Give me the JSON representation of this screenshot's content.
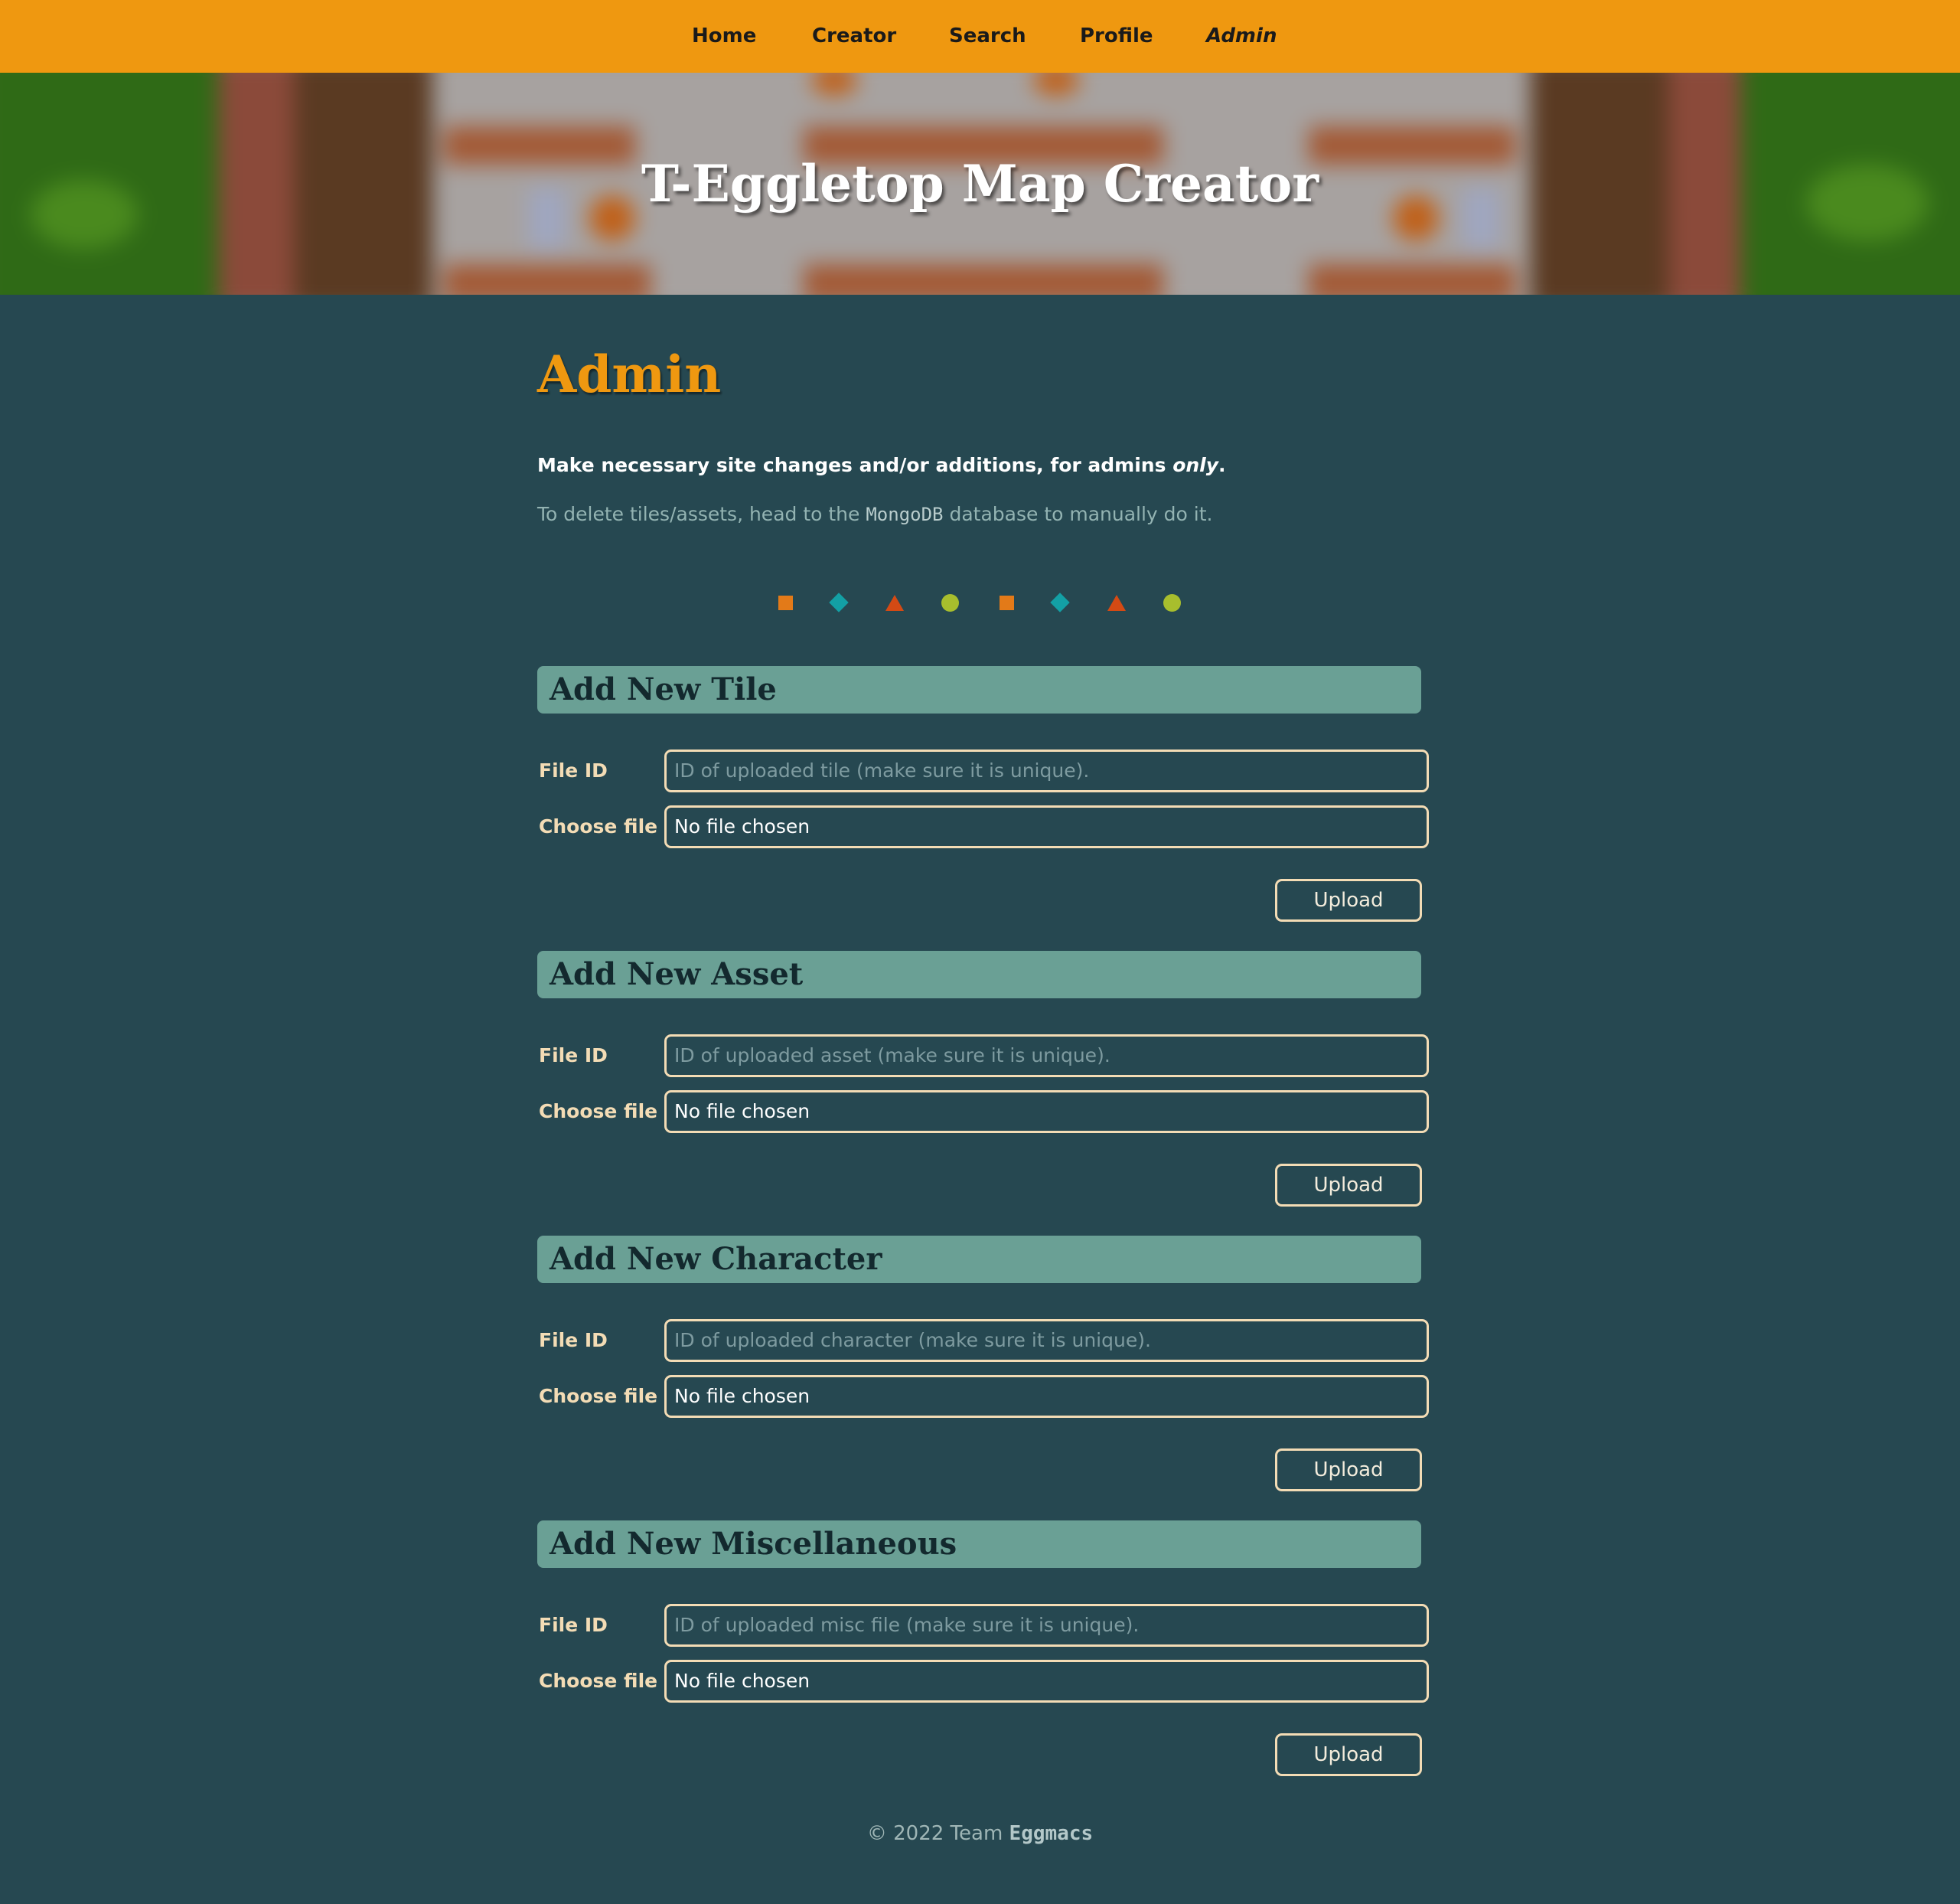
{
  "nav": {
    "items": [
      {
        "label": "Home",
        "active": false
      },
      {
        "label": "Creator",
        "active": false
      },
      {
        "label": "Search",
        "active": false
      },
      {
        "label": "Profile",
        "active": false
      },
      {
        "label": "Admin",
        "active": true
      }
    ],
    "background": "#ef9810"
  },
  "hero": {
    "title": "T-Eggletop Map Creator"
  },
  "page": {
    "heading": "Admin",
    "intro_prefix": "Make necessary site changes and/or additions, for admins ",
    "intro_emphasis": "only",
    "intro_suffix": ".",
    "note_prefix": "To delete tiles/assets, head to the ",
    "note_code": "MongoDB",
    "note_suffix": " database to manually do it."
  },
  "divider_shapes": [
    "orange-square",
    "teal-diamond",
    "red-triangle",
    "lime-circle",
    "orange-square",
    "teal-diamond",
    "red-triangle",
    "lime-circle"
  ],
  "colors": {
    "accent": "#ef9810",
    "background": "#264851",
    "section_bar": "#6aa095",
    "field_border": "#f3dcb5"
  },
  "sections": [
    {
      "title": "Add New Tile",
      "file_id_label": "File ID",
      "file_id_placeholder": "ID of uploaded tile (make sure it is unique).",
      "choose_label": "Choose file",
      "choose_value": "No file chosen",
      "upload_label": "Upload"
    },
    {
      "title": "Add New Asset",
      "file_id_label": "File ID",
      "file_id_placeholder": "ID of uploaded asset (make sure it is unique).",
      "choose_label": "Choose file",
      "choose_value": "No file chosen",
      "upload_label": "Upload"
    },
    {
      "title": "Add New Character",
      "file_id_label": "File ID",
      "file_id_placeholder": "ID of uploaded character (make sure it is unique).",
      "choose_label": "Choose file",
      "choose_value": "No file chosen",
      "upload_label": "Upload"
    },
    {
      "title": "Add New Miscellaneous",
      "file_id_label": "File ID",
      "file_id_placeholder": "ID of uploaded misc file (make sure it is unique).",
      "choose_label": "Choose file",
      "choose_value": "No file chosen",
      "upload_label": "Upload"
    }
  ],
  "footer": {
    "prefix": "© 2022 Team ",
    "team": "Eggmacs"
  }
}
